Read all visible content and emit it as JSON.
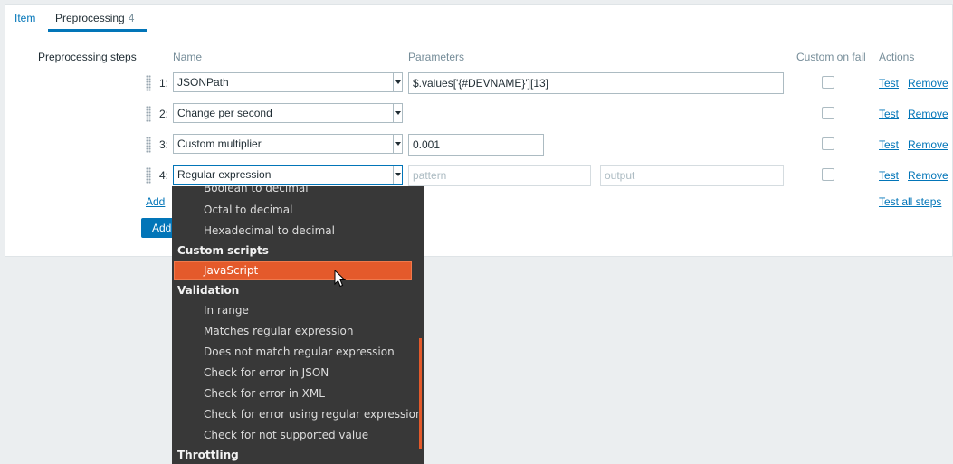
{
  "tabs": [
    {
      "label": "Item"
    },
    {
      "label": "Preprocessing",
      "count": "4"
    }
  ],
  "section_label": "Preprocessing steps",
  "headers": {
    "name": "Name",
    "parameters": "Parameters",
    "custom_on_fail": "Custom on fail",
    "actions": "Actions"
  },
  "steps": [
    {
      "num": "1:",
      "name": "JSONPath",
      "param1": "$.values['{#DEVNAME}'][13]"
    },
    {
      "num": "2:",
      "name": "Change per second"
    },
    {
      "num": "3:",
      "name": "Custom multiplier",
      "param1": "0.001"
    },
    {
      "num": "4:",
      "name": "Regular expression",
      "param1_placeholder": "pattern",
      "param2_placeholder": "output"
    }
  ],
  "actions": {
    "test": "Test",
    "remove": "Remove",
    "test_all": "Test all steps"
  },
  "add_link": "Add",
  "add_button": "Add",
  "dropdown": {
    "items_top": [
      "Boolean to decimal",
      "Octal to decimal",
      "Hexadecimal to decimal"
    ],
    "group_custom": "Custom scripts",
    "selected": "JavaScript",
    "group_validation": "Validation",
    "validation_items": [
      "In range",
      "Matches regular expression",
      "Does not match regular expression",
      "Check for error in JSON",
      "Check for error in XML",
      "Check for error using regular expression",
      "Check for not supported value"
    ],
    "group_throttling": "Throttling"
  },
  "colors": {
    "accent": "#0275b8",
    "dropdown_bg": "#383838",
    "selected": "#e45a2b"
  }
}
